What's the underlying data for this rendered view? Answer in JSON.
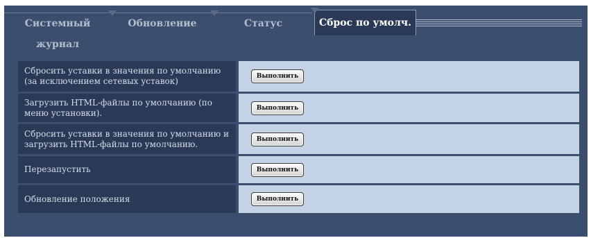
{
  "tabs": [
    {
      "label": "Системный журнал"
    },
    {
      "label": "Обновление"
    },
    {
      "label": "Статус"
    },
    {
      "label": "Сброс по умолч."
    }
  ],
  "rows": [
    {
      "label": "Сбросить уставки в значения по умолчанию (за исключением сетевых уставок)",
      "button": "Выполнить"
    },
    {
      "label": "Загрузить HTML-файлы по умолчанию (по меню установки).",
      "button": "Выполнить"
    },
    {
      "label": "Сбросить уставки в значения по умолчанию и загрузить HTML-файлы по умолчанию.",
      "button": "Выполнить"
    },
    {
      "label": "Перезапустить",
      "button": "Выполнить"
    },
    {
      "label": "Обновление положения",
      "button": "Выполнить"
    }
  ],
  "colors": {
    "panel": "#3b4e6d",
    "label_bg": "#2a3a56",
    "cell_bg": "#c4d2e6",
    "active_tab_text": "#ffffff"
  }
}
